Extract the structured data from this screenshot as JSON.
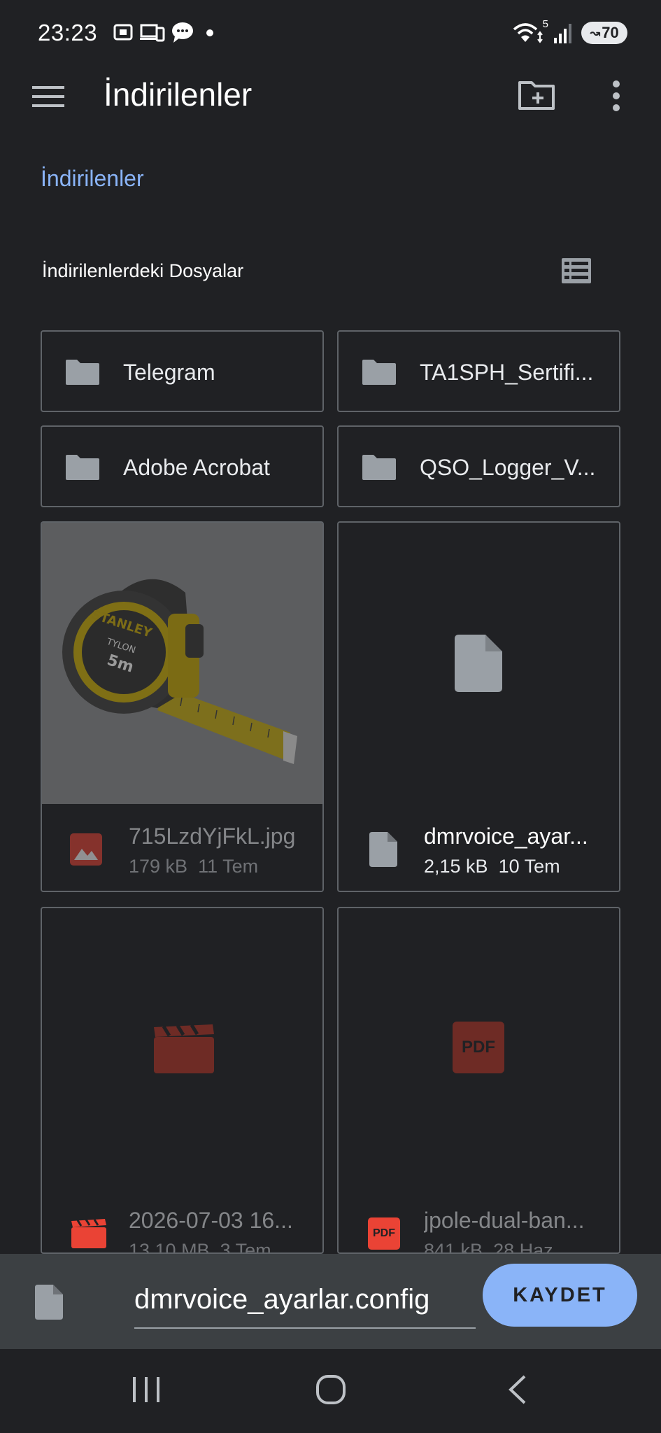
{
  "status_bar": {
    "time": "23:23",
    "wifi_badge": "5",
    "battery": "70"
  },
  "app_bar": {
    "title": "İndirilenler"
  },
  "breadcrumb": {
    "label": "İndirilenler"
  },
  "section": {
    "title": "İndirilenlerdeki Dosyalar"
  },
  "folders": [
    {
      "name": "Telegram"
    },
    {
      "name": "TA1SPH_Sertifi..."
    },
    {
      "name": "Adobe Acrobat"
    },
    {
      "name": "QSO_Logger_V..."
    }
  ],
  "files": [
    {
      "name": "715LzdYjFkL.jpg",
      "size": "179 kB",
      "date": "11 Tem",
      "icon": "image-icon",
      "enabled": false
    },
    {
      "name": "dmrvoice_ayar...",
      "size": "2,15 kB",
      "date": "10 Tem",
      "icon": "file-icon",
      "enabled": true
    },
    {
      "name": "2026-07-03 16...",
      "size": "13,10 MB",
      "date": "3 Tem",
      "icon": "video-icon",
      "enabled": false
    },
    {
      "name": "jpole-dual-ban...",
      "size": "841 kB",
      "date": "28 Haz",
      "icon": "pdf-icon",
      "enabled": false
    }
  ],
  "pdf_label": "PDF",
  "thumbnail_brand": {
    "brand": "STANLEY",
    "model": "TYLON",
    "length": "5m"
  },
  "save_bar": {
    "filename": "dmrvoice_ayarlar.config",
    "save_label": "KAYDET"
  },
  "colors": {
    "background": "#202124",
    "accent": "#8ab4f8",
    "image_red": "#ea4335",
    "border": "#5f6368"
  }
}
